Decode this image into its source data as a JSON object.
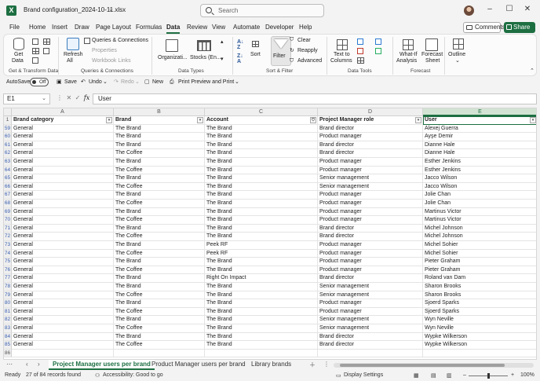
{
  "window": {
    "title": "Brand configuration_2024-10-11.xlsx",
    "search_placeholder": "Search",
    "minimize": "–",
    "maximize": "☐",
    "close": "✕"
  },
  "menu": [
    "File",
    "Home",
    "Insert",
    "Draw",
    "Page Layout",
    "Formulas",
    "Data",
    "Review",
    "View",
    "Automate",
    "Developer",
    "Help"
  ],
  "active_menu": "Data",
  "comments_label": "Comments",
  "share_label": "Share",
  "ribbon": {
    "get_data_line1": "Get",
    "get_data_line2": "Data",
    "group_get_transform": "Get & Transform Data",
    "refresh_line1": "Refresh",
    "refresh_line2": "All",
    "queries_connections": "Queries & Connections",
    "properties": "Properties",
    "workbook_links": "Workbook Links",
    "group_queries": "Queries & Connections",
    "dt_organization": "Organizati...",
    "dt_stocks": "Stocks (En...",
    "group_data_types": "Data Types",
    "sort": "Sort",
    "filter": "Filter",
    "clear": "Clear",
    "reapply": "Reapply",
    "advanced": "Advanced",
    "group_sort_filter": "Sort & Filter",
    "text_to_columns_1": "Text to",
    "text_to_columns_2": "Columns",
    "group_data_tools": "Data Tools",
    "whatif_1": "What-If",
    "whatif_2": "Analysis",
    "forecast_1": "Forecast",
    "forecast_2": "Sheet",
    "group_forecast": "Forecast",
    "outline": "Outline"
  },
  "qat": {
    "autosave": "AutoSave",
    "autosave_state": "Off",
    "save": "Save",
    "undo": "Undo",
    "redo": "Redo",
    "new": "New",
    "print_preview": "Print Preview and Print"
  },
  "formula_bar": {
    "name_box": "E1",
    "fx": "fx",
    "value": "User"
  },
  "columns": [
    "A",
    "B",
    "C",
    "D",
    "E"
  ],
  "headers": [
    "Brand category",
    "Brand",
    "Account",
    "Project Manager role",
    "User"
  ],
  "rows": [
    {
      "n": "59",
      "c": [
        "General",
        "The Brand",
        "The Brand",
        "Brand director",
        "Alexej Guerra"
      ]
    },
    {
      "n": "60",
      "c": [
        "General",
        "The Brand",
        "The Brand",
        "Product manager",
        "Ayşe Demir"
      ]
    },
    {
      "n": "61",
      "c": [
        "General",
        "The Brand",
        "The Brand",
        "Brand director",
        "Dianne Hale"
      ]
    },
    {
      "n": "62",
      "c": [
        "General",
        "The Coffee",
        "The Brand",
        "Brand director",
        "Dianne Hale"
      ]
    },
    {
      "n": "63",
      "c": [
        "General",
        "The Brand",
        "The Brand",
        "Product manager",
        "Esther Jenkins"
      ]
    },
    {
      "n": "64",
      "c": [
        "General",
        "The Coffee",
        "The Brand",
        "Product manager",
        "Esther Jenkins"
      ]
    },
    {
      "n": "65",
      "c": [
        "General",
        "The Brand",
        "The Brand",
        "Senior management",
        "Jacco Wilson"
      ]
    },
    {
      "n": "66",
      "c": [
        "General",
        "The Coffee",
        "The Brand",
        "Senior management",
        "Jacco Wilson"
      ]
    },
    {
      "n": "67",
      "c": [
        "General",
        "The Brand",
        "The Brand",
        "Product manager",
        "Jolie Chan"
      ]
    },
    {
      "n": "68",
      "c": [
        "General",
        "The Coffee",
        "The Brand",
        "Product manager",
        "Jolie Chan"
      ]
    },
    {
      "n": "69",
      "c": [
        "General",
        "The Brand",
        "The Brand",
        "Product manager",
        "Martinus Victor"
      ]
    },
    {
      "n": "70",
      "c": [
        "General",
        "The Coffee",
        "The Brand",
        "Product manager",
        "Martinus Victor"
      ]
    },
    {
      "n": "71",
      "c": [
        "General",
        "The Brand",
        "The Brand",
        "Brand director",
        "Michel Johnson"
      ]
    },
    {
      "n": "72",
      "c": [
        "General",
        "The Coffee",
        "The Brand",
        "Brand director",
        "Michel Johnson"
      ]
    },
    {
      "n": "73",
      "c": [
        "General",
        "The Brand",
        "Peek RF",
        "Product manager",
        "Michel Sohier"
      ]
    },
    {
      "n": "74",
      "c": [
        "General",
        "The Coffee",
        "Peek RF",
        "Product manager",
        "Michel Sohier"
      ]
    },
    {
      "n": "75",
      "c": [
        "General",
        "The Brand",
        "The Brand",
        "Product manager",
        "Pieter Graham"
      ]
    },
    {
      "n": "76",
      "c": [
        "General",
        "The Coffee",
        "The Brand",
        "Product manager",
        "Pieter Graham"
      ]
    },
    {
      "n": "77",
      "c": [
        "General",
        "The Brand",
        "Right On Impact",
        "Brand director",
        "Roland van Dam"
      ]
    },
    {
      "n": "78",
      "c": [
        "General",
        "The Brand",
        "The Brand",
        "Senior management",
        "Sharon Brooks"
      ]
    },
    {
      "n": "79",
      "c": [
        "General",
        "The Coffee",
        "The Brand",
        "Senior management",
        "Sharon Brooks"
      ]
    },
    {
      "n": "80",
      "c": [
        "General",
        "The Brand",
        "The Brand",
        "Product manager",
        "Sjoerd Sparks"
      ]
    },
    {
      "n": "81",
      "c": [
        "General",
        "The Coffee",
        "The Brand",
        "Product manager",
        "Sjoerd Sparks"
      ]
    },
    {
      "n": "82",
      "c": [
        "General",
        "The Brand",
        "The Brand",
        "Senior management",
        "Wyn Neville"
      ]
    },
    {
      "n": "83",
      "c": [
        "General",
        "The Coffee",
        "The Brand",
        "Senior management",
        "Wyn Neville"
      ]
    },
    {
      "n": "84",
      "c": [
        "General",
        "The Brand",
        "The Brand",
        "Brand director",
        "Wypke Wilkerson"
      ]
    },
    {
      "n": "85",
      "c": [
        "General",
        "The Coffee",
        "The Brand",
        "Brand director",
        "Wypke Wilkerson"
      ]
    },
    {
      "n": "86",
      "c": [
        "",
        "",
        "",
        "",
        ""
      ]
    }
  ],
  "sheet_tabs": [
    "Project Manager users per brand",
    "Product Manager users per brand",
    "Library brands"
  ],
  "active_sheet": 0,
  "status": {
    "ready": "Ready",
    "records": "27 of 84 records found",
    "accessibility": "Accessibility: Good to go",
    "display_settings": "Display Settings",
    "zoom": "100%"
  }
}
